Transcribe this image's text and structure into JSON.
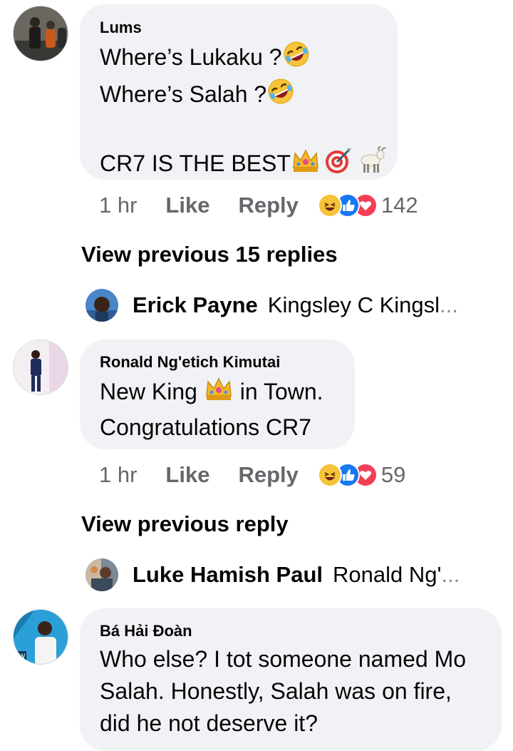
{
  "comments": [
    {
      "author": "Lums",
      "lines": [
        "Where’s Lukaku ?",
        "Where’s Salah ?",
        "",
        "CR7 IS THE BEST"
      ],
      "time": "1 hr",
      "like_label": "Like",
      "reply_label": "Reply",
      "reaction_count": "142",
      "view_previous": "View previous 15 replies",
      "latest_reply": {
        "author": "Erick Payne",
        "text": "Kingsley C Kingsl",
        "ellipsis": "..."
      }
    },
    {
      "author": "Ronald Ng'etich Kimutai",
      "lines": [
        "New King ",
        " in Town.",
        "Congratulations CR7"
      ],
      "time": "1 hr",
      "like_label": "Like",
      "reply_label": "Reply",
      "reaction_count": "59",
      "view_previous": "View previous reply",
      "latest_reply": {
        "author": "Luke Hamish Paul",
        "text": "Ronald Ng'",
        "ellipsis": "..."
      }
    },
    {
      "author": "Bá Hải Đoàn",
      "lines": [
        "Who else? I tot someone named Mo",
        "Salah. Honestly, Salah was on fire,",
        "did he not deserve it?"
      ]
    }
  ],
  "icons": {
    "reactions": [
      "haha-icon",
      "like-icon",
      "love-icon"
    ],
    "comment_emojis": [
      "rofl-emoji-icon",
      "crown-emoji-icon",
      "bullseye-emoji-icon",
      "goat-emoji-icon"
    ]
  },
  "colors": {
    "bubble": "#f0f2f5",
    "secondary_text": "#65676b",
    "like_blue": "#1877f2",
    "love_red": "#f33e58",
    "haha_yellow": "#f7c33a"
  }
}
